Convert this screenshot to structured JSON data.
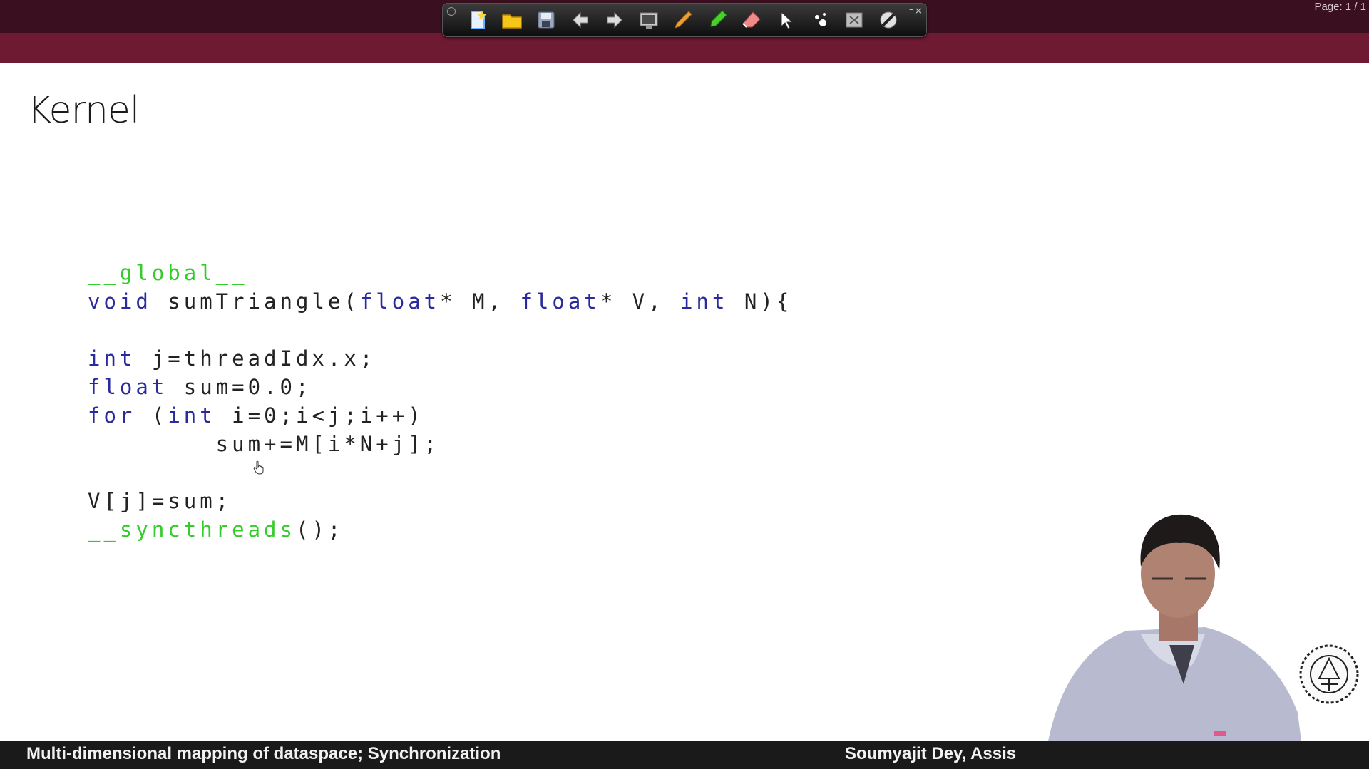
{
  "window": {
    "page_indicator": "Page: 1 / 1"
  },
  "toolbar": {
    "tools": [
      {
        "name": "new-page-icon",
        "color": "#6cb4ff"
      },
      {
        "name": "open-folder-icon",
        "color": "#f5c518"
      },
      {
        "name": "save-icon",
        "color": "#9aa7c0"
      },
      {
        "name": "previous-page-icon",
        "color": "#dcdcdc"
      },
      {
        "name": "next-page-icon",
        "color": "#dcdcdc"
      },
      {
        "name": "screen-icon",
        "color": "#c9c9c9"
      },
      {
        "name": "pen-icon",
        "color": "#f0a030"
      },
      {
        "name": "highlighter-icon",
        "color": "#47d12a"
      },
      {
        "name": "eraser-icon",
        "color": "#f08a8a"
      },
      {
        "name": "pointer-icon",
        "color": "#ffffff"
      },
      {
        "name": "laser-icon",
        "color": "#ffffff"
      },
      {
        "name": "clear-icon",
        "color": "#bdbdbd"
      },
      {
        "name": "stop-icon",
        "color": "#e0e0e0"
      }
    ]
  },
  "slide": {
    "title": "Kernel",
    "code": [
      [
        {
          "t": "__global__",
          "c": "cuda"
        }
      ],
      [
        {
          "t": "void",
          "c": "kw"
        },
        {
          "t": " sumTriangle(",
          "c": "p"
        },
        {
          "t": "float",
          "c": "kw"
        },
        {
          "t": "* M, ",
          "c": "p"
        },
        {
          "t": "float",
          "c": "kw"
        },
        {
          "t": "* V, ",
          "c": "p"
        },
        {
          "t": "int",
          "c": "kw"
        },
        {
          "t": " N){",
          "c": "p"
        }
      ],
      [],
      [
        {
          "t": "int",
          "c": "kw"
        },
        {
          "t": " j=threadIdx.x;",
          "c": "p"
        }
      ],
      [
        {
          "t": "float",
          "c": "kw"
        },
        {
          "t": " sum=0.0;",
          "c": "p"
        }
      ],
      [
        {
          "t": "for",
          "c": "kw"
        },
        {
          "t": " (",
          "c": "p"
        },
        {
          "t": "int",
          "c": "kw"
        },
        {
          "t": " i=0;i<j;i++)",
          "c": "p"
        }
      ],
      [
        {
          "t": "        sum+=M[i*N+j];",
          "c": "p"
        }
      ],
      [],
      [
        {
          "t": "V[j]=sum;",
          "c": "p"
        }
      ],
      [
        {
          "t": "__syncthreads",
          "c": "cuda"
        },
        {
          "t": "();",
          "c": "p"
        }
      ]
    ]
  },
  "footer": {
    "left": "Multi-dimensional mapping of dataspace; Synchronization",
    "right": "Soumyajit Dey, Assis"
  }
}
